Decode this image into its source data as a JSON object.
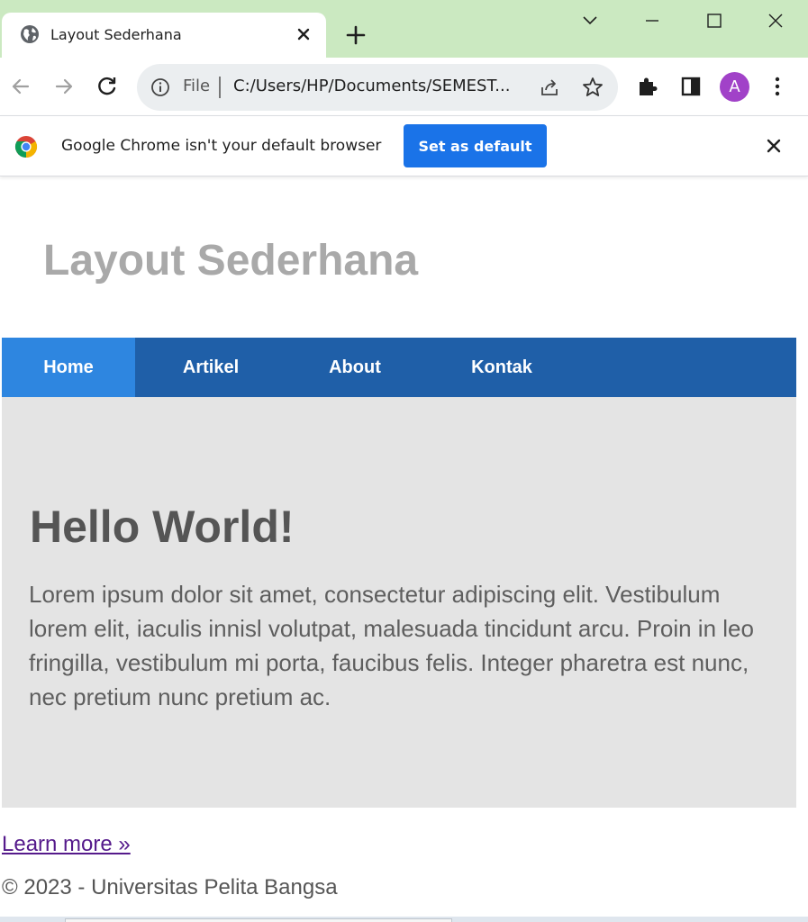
{
  "browser": {
    "tab_title": "Layout Sederhana",
    "address_scheme": "File",
    "address_url": "C:/Users/HP/Documents/SEMEST...",
    "profile_initial": "A",
    "icons": {
      "tab": "globe-icon",
      "tab_close": "close-icon",
      "new_tab": "plus-icon",
      "back": "arrow-left-icon",
      "forward": "arrow-right-icon",
      "reload": "reload-icon",
      "info": "info-icon",
      "share": "share-icon",
      "bookmark": "star-icon",
      "extensions": "puzzle-icon",
      "side_panel": "side-panel-icon",
      "menu": "kebab-menu-icon"
    }
  },
  "infobar": {
    "message": "Google Chrome isn't your default browser",
    "button_label": "Set as default"
  },
  "page": {
    "site_title": "Layout Sederhana",
    "nav": [
      {
        "label": "Home",
        "active": true
      },
      {
        "label": "Artikel",
        "active": false
      },
      {
        "label": "About",
        "active": false
      },
      {
        "label": "Kontak",
        "active": false
      }
    ],
    "hero": {
      "heading": "Hello World!",
      "body": "Lorem ipsum dolor sit amet, consectetur adipiscing elit. Vestibulum lorem elit, iaculis innisl volutpat, malesuada tincidunt arcu. Proin in leo fringilla, vestibulum mi porta, faucibus felis. Integer pharetra est nunc, nec pretium nunc pretium ac."
    },
    "learn_more": "Learn more »",
    "footer": "© 2023 - Universitas Pelita Bangsa"
  },
  "colors": {
    "tabbar_bg": "#cbe9c1",
    "nav_bg": "#1f5fa8",
    "nav_active": "#2e86e0",
    "hero_bg": "#e4e4e4",
    "button_blue": "#1a73e8",
    "avatar": "#a142c8"
  }
}
